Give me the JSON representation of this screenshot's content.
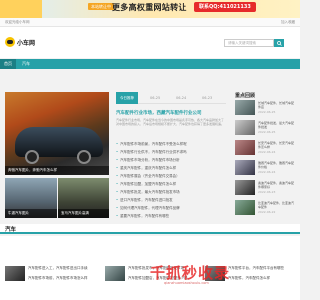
{
  "banner": {
    "sale_badge": "本站转让中",
    "headline": "更多高权重网站转让",
    "contact": "联系QQ:411021133"
  },
  "topbar": {
    "welcome": "欢迎光临小车网",
    "links": "加入收藏"
  },
  "header": {
    "site_name": "小车网",
    "search_placeholder": "请输入关键词搜索"
  },
  "nav": {
    "items": [
      "首页",
      "汽车"
    ]
  },
  "main": {
    "main_caption": "奔驰汽车图片，奔驰汽车怎么样",
    "thumb_captions": [
      "牛逼汽车图片",
      "宝马汽车图片高清"
    ],
    "tabs": [
      "今日推荐",
      "06-25",
      "06-24",
      "06-23"
    ],
    "featured_title": "汽车配件行业市场，西藏汽车配件行业公司",
    "summary": "汽车配件行业市场，汽车配件在当今的中国市场是炙手可热，各大汽车品牌加大了对中国市场的投入，汽车后市场规模不断扩大，汽车配件也获得了更多发展机遇。",
    "news": [
      "汽车配件市场前景，汽车配件不受怎么样呢",
      "汽车配件行业供不，汽车配件行业供不求吗",
      "汽车配件市场分析，汽车配件市场分析",
      "重庆汽车配件，重庆汽车配件怎么样",
      "汽车配件展会（齐全汽车配件交易会）",
      "汽车配件加盟，加盟汽车配件怎么样",
      "汽车配件批发，最大汽车配件批发市场",
      "进口汽车配件，汽车配件进口批发",
      "如何代理汽车配件，代理汽车配件品牌",
      "重要汽车配件，汽车配件有哪些"
    ]
  },
  "sidebar": {
    "title": "重点回顾",
    "items": [
      {
        "text": "长城汽车配件，长城汽车配件店",
        "date": "2022-06-25"
      },
      {
        "text": "汽车配件批发，最大汽车配件批发",
        "date": "2022-06-25"
      },
      {
        "text": "长安汽车配件，长安汽车配件怎么样",
        "date": "2022-06-24"
      },
      {
        "text": "雅阁汽车配件，雅阁汽车配件价格",
        "date": "2022-06-24"
      },
      {
        "text": "奥迪汽车配件，奥迪汽车配件哪家好",
        "date": "2022-06-23"
      },
      {
        "text": "比亚迪汽车配件，比亚迪汽车配件",
        "date": "2022-06-22"
      }
    ]
  },
  "section": {
    "title": "汽车"
  },
  "bottom": {
    "items": [
      "汽车配件进入工，汽车配件进出口手续",
      "汽车配件市场前，汽车配件市场怎么样",
      "汽车配件批发市，汽车配件批发市场",
      "汽车配件加盟店，汽车配件加盟多少钱",
      "汽车配件平台，汽车配件平台有哪些",
      "汽车配件，汽车配件怎么样"
    ]
  },
  "watermark": {
    "text": "千抓秒收录",
    "sub": "qianzhuamiaoshoulu.com"
  },
  "colors": {
    "accent": "#27a2a8",
    "nav_bg": "#26a1a8",
    "banner_contact": "#e62b2b",
    "watermark": "#e62828"
  }
}
